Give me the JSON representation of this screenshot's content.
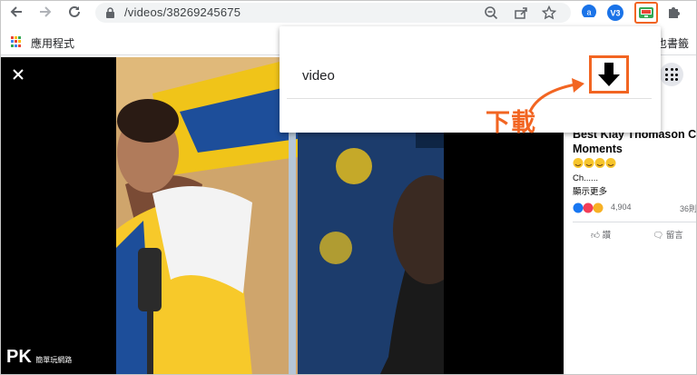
{
  "browser": {
    "back_icon": "arrow-left-icon",
    "forward_icon": "arrow-right-icon",
    "reload_icon": "reload-icon",
    "url": "/videos/38269245675",
    "zoom_icon": "zoom-out-icon",
    "share_icon": "share-icon",
    "bookmark_icon": "star-icon",
    "extensions_icon": "puzzle-icon",
    "extension_badge_label": "V3"
  },
  "bookmarks": {
    "apps_label": "應用程式",
    "right_label": "也書籤"
  },
  "popup": {
    "item_label": "video",
    "download_icon": "download-arrow-icon",
    "annotation": "下載",
    "accent": "#f26522"
  },
  "viewer": {
    "close_icon": "close-icon",
    "menu_icon": "grid-menu-icon"
  },
  "post": {
    "title_line1": "Best Klay Thomason C",
    "title_line2": "Moments",
    "text": "Ch......",
    "see_more": "顯示更多",
    "reaction_count": "4,904",
    "comment_count": "36則",
    "like_label": "讚",
    "comment_label": "留言"
  },
  "watermark": {
    "text": "PK",
    "subtext": "簡單玩網路"
  }
}
